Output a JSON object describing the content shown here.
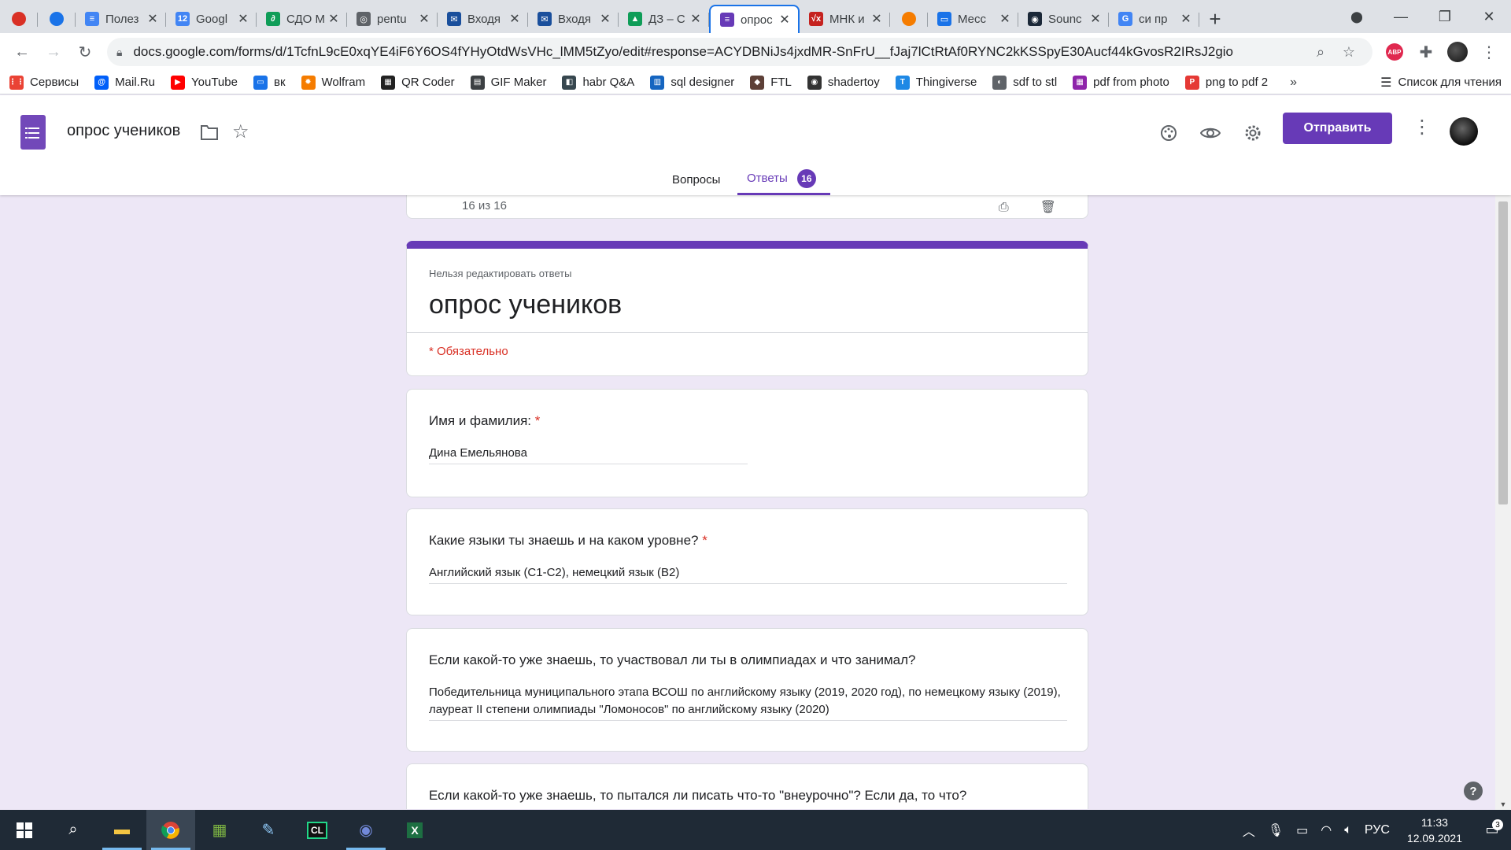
{
  "browser": {
    "tabs": [
      {
        "title": "",
        "color": "#d93025",
        "small": true
      },
      {
        "title": "",
        "color": "#1a73e8",
        "small": true
      },
      {
        "title": "Полез",
        "color": "#4285f4",
        "glyph": "≡"
      },
      {
        "title": "Googl",
        "color": "#4285f4",
        "glyph": "12"
      },
      {
        "title": "СДО М",
        "color": "#0f9d58",
        "glyph": "∂"
      },
      {
        "title": "pentu",
        "color": "#5f6368",
        "glyph": "◎"
      },
      {
        "title": "Входя",
        "color": "#1a4f9c",
        "glyph": "✉"
      },
      {
        "title": "Входя",
        "color": "#1a4f9c",
        "glyph": "✉"
      },
      {
        "title": "ДЗ – С",
        "color": "#0f9d58",
        "glyph": "▲"
      },
      {
        "title": "опрос",
        "color": "#673ab7",
        "glyph": "≡",
        "active": true
      },
      {
        "title": "МНК и",
        "color": "#c5221f",
        "glyph": "√x"
      },
      {
        "title": "",
        "color": "#f57c00",
        "small": true
      },
      {
        "title": "Месс",
        "color": "#1a73e8",
        "glyph": "▭"
      },
      {
        "title": "Sounc",
        "color": "#1b2838",
        "glyph": "◉"
      },
      {
        "title": "си пр",
        "color": "#4285f4",
        "glyph": "G"
      }
    ],
    "address": "docs.google.com/forms/d/1TcfnL9cE0xqYE4iF6Y6OS4fYHyOtdWsVHc_lMM5tZyo/edit#response=ACYDBNiJs4jxdMR-SnFrU__fJaj7lCtRtAf0RYNC2kKSSpyE30Aucf44kGvosR2IRsJ2gio",
    "extension_abp": "ABP",
    "bookmarks": [
      {
        "label": "Сервисы",
        "color": "#ea4335",
        "glyph": "⋮⋮"
      },
      {
        "label": "Mail.Ru",
        "color": "#005ff9",
        "glyph": "@"
      },
      {
        "label": "YouTube",
        "color": "#ff0000",
        "glyph": "▶"
      },
      {
        "label": "вк",
        "color": "#1a73e8",
        "glyph": "▭"
      },
      {
        "label": "Wolfram",
        "color": "#f57c00",
        "glyph": "✹"
      },
      {
        "label": "QR Coder",
        "color": "#222222",
        "glyph": "▦"
      },
      {
        "label": "GIF Maker",
        "color": "#3c4043",
        "glyph": "▤"
      },
      {
        "label": "habr Q&A",
        "color": "#37474f",
        "glyph": "◧"
      },
      {
        "label": "sql designer",
        "color": "#1565c0",
        "glyph": "▥"
      },
      {
        "label": "FTL",
        "color": "#5d4037",
        "glyph": "◆"
      },
      {
        "label": "shadertoy",
        "color": "#333333",
        "glyph": "◉"
      },
      {
        "label": "Thingiverse",
        "color": "#1e88e5",
        "glyph": "T"
      },
      {
        "label": "sdf to stl",
        "color": "#5f6368",
        "glyph": "◐"
      },
      {
        "label": "pdf from photo",
        "color": "#8e24aa",
        "glyph": "▦"
      },
      {
        "label": "png to pdf 2",
        "color": "#e53935",
        "glyph": "P"
      }
    ],
    "more": "»",
    "reading_list": "Список для чтения"
  },
  "forms": {
    "title": "опрос учеников",
    "send_label": "Отправить",
    "tab_questions": "Вопросы",
    "tab_responses": "Ответы",
    "responses_count": "16",
    "nav_text": "16   из   16",
    "form_card": {
      "note": "Нельзя редактировать ответы",
      "title": "опрос учеников",
      "required_note": "* Обязательно"
    },
    "questions": [
      {
        "text": "Имя и фамилия:",
        "required": true,
        "answer": "Дина Емельянова"
      },
      {
        "text": "Какие языки ты знаешь и на каком уровне?",
        "required": true,
        "answer": "Английский язык (C1-C2), немецкий язык (B2)"
      },
      {
        "text": "Если какой-то уже знаешь, то участвовал ли ты в олимпиадах и что занимал?",
        "required": false,
        "answer": "Победительница муниципального этапа ВСОШ по английскому языку (2019, 2020 год), по немецкому языку (2019), лауреат II степени олимпиады \"Ломоносов\" по английскому языку (2020)"
      },
      {
        "text": "Если какой-то уже знаешь, то пытался ли писать что-то \"внеурочно\"? Если да, то что?",
        "required": false,
        "answer": ""
      }
    ],
    "help": "?"
  },
  "taskbar": {
    "lang": "РУС",
    "time": "11:33",
    "date": "12.09.2021",
    "notifications": "3"
  }
}
